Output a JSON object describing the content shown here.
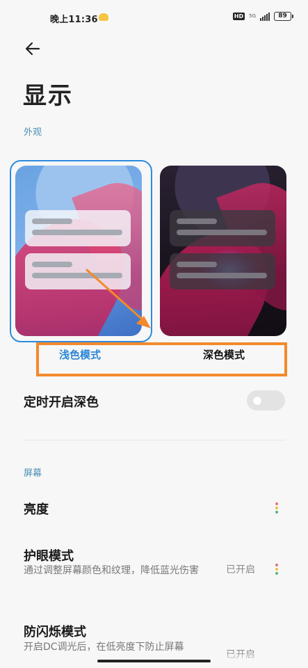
{
  "status_bar": {
    "time": "晚上11:36",
    "hd": "HD",
    "network": "5G",
    "battery": "89"
  },
  "icons": {
    "back": "arrow-left-icon",
    "weather": "cloud-icon",
    "more": "vertical-dots-icon"
  },
  "page": {
    "title": "显示"
  },
  "appearance": {
    "section_label": "外观",
    "selected_mode": "light",
    "modes": [
      {
        "label": "浅色模式",
        "selected": true
      },
      {
        "label": "深色模式",
        "selected": false
      }
    ]
  },
  "schedule_dark": {
    "title": "定时开启深色",
    "enabled": false
  },
  "screen": {
    "section_label": "屏幕",
    "brightness": {
      "title": "亮度"
    },
    "eye_care": {
      "title": "护眼模式",
      "description": "通过调整屏幕颜色和纹理，降低蓝光伤害",
      "status": "已开启"
    },
    "anti_flicker": {
      "title": "防闪烁模式",
      "description": "开启DC调光后，在低亮度下防止屏幕",
      "status": "已开启"
    }
  },
  "colors": {
    "accent": "#2b86d6",
    "section": "#4a8fb4",
    "annotation": "#f28a2c",
    "dot_red": "#e57373",
    "dot_yellow": "#f0c04a",
    "dot_green": "#55b87a"
  }
}
